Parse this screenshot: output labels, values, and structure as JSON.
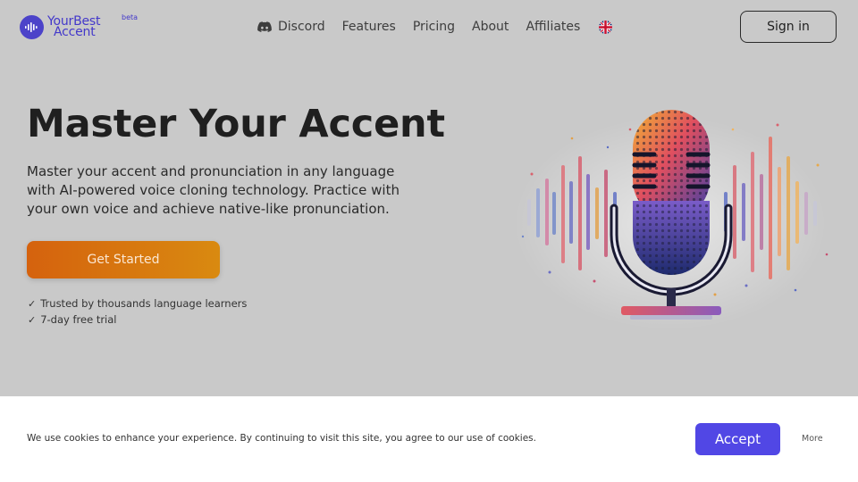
{
  "header": {
    "logo": {
      "line1": "YourBest",
      "line2": "Accent",
      "badge": "beta"
    },
    "nav": [
      {
        "label": "Discord",
        "icon": "discord-icon"
      },
      {
        "label": "Features"
      },
      {
        "label": "Pricing"
      },
      {
        "label": "About"
      },
      {
        "label": "Affiliates"
      }
    ],
    "language_icon": "uk-flag-icon",
    "signin_label": "Sign in"
  },
  "hero": {
    "title": "Master Your Accent",
    "description": "Master your accent and pronunciation in any language with AI-powered voice cloning technology. Practice with your own voice and achieve native-like pronunciation.",
    "cta_label": "Get Started",
    "checks": [
      "Trusted by thousands language learners",
      "7-day free trial"
    ],
    "illustration_icon": "microphone-soundwave-illustration"
  },
  "cookie_banner": {
    "text": "We use cookies to enhance your experience. By continuing to visit this site, you agree to our use of cookies.",
    "accept_label": "Accept",
    "more_label": "More"
  },
  "colors": {
    "background": "#c9c9c9",
    "brand": "#4338ca",
    "cta_start": "#d5620e",
    "cta_end": "#d98a10",
    "accept": "#5147e5"
  }
}
